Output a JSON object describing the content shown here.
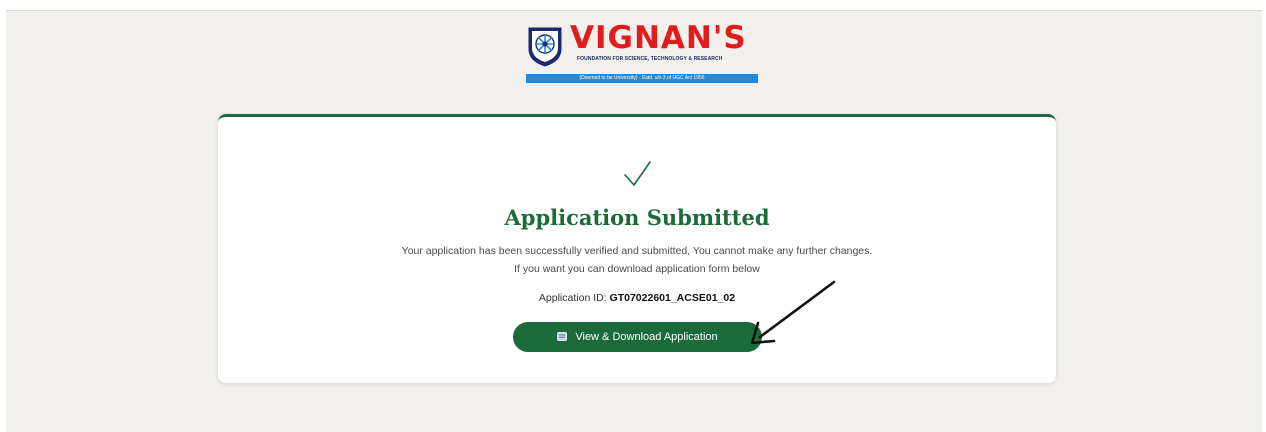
{
  "logo": {
    "name": "VIGNAN'S",
    "tagline": "FOUNDATION FOR SCIENCE, TECHNOLOGY & RESEARCH",
    "band": "(Deemed to be University) - Estd. u/s 3 of UGC Act 1956",
    "brand_color": "#e01c1c",
    "band_color": "#1f8be0",
    "emblem_icon": "university-emblem-icon"
  },
  "card": {
    "status_icon": "checkmark-icon",
    "title": "Application Submitted",
    "message_line1": "Your application has been successfully verified and submitted, You cannot make any further changes.",
    "message_line2": "If you want you can download application form below",
    "app_id_label": "Application ID:",
    "app_id_value": "GT07022601_ACSE01_02",
    "download_button_label": "View & Download Application",
    "download_button_icon": "document-icon",
    "accent_color": "#1b6a3a"
  },
  "annotation": {
    "icon": "pointer-arrow-icon"
  }
}
